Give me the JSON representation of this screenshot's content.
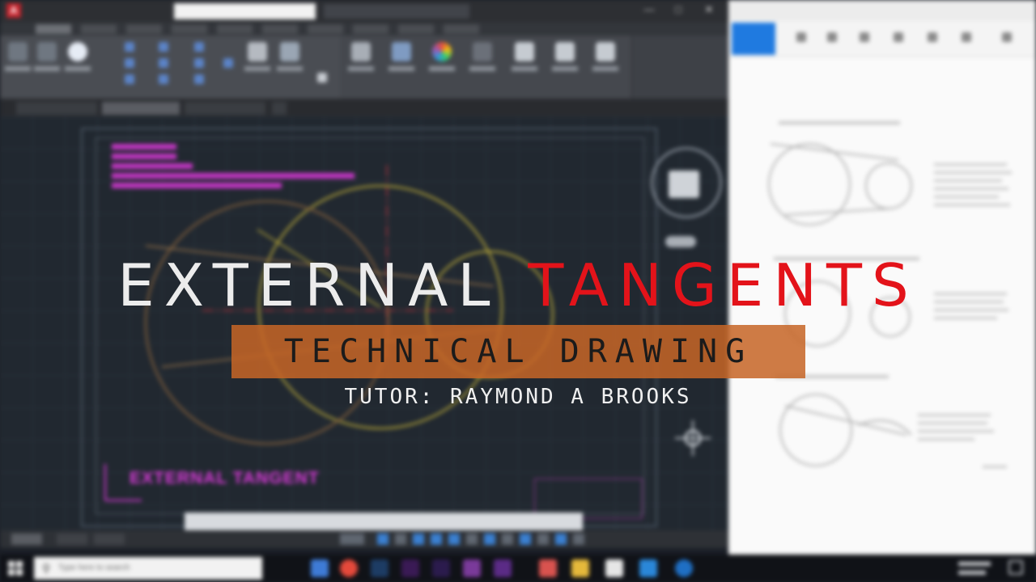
{
  "overlay": {
    "headline_word1": "EXTERNAL",
    "headline_word2": "TANGENTS",
    "subtitle": "TECHNICAL DRAWING",
    "tutor": "TUTOR: RAYMOND A BROOKS",
    "colors": {
      "headline_white": "#ececec",
      "headline_red": "#e3131a",
      "subtitle_band": "#c66527",
      "subtitle_text": "#1b1b1b"
    }
  },
  "autocad": {
    "drawing_label": "EXTERNAL TANGENT",
    "colors": {
      "annotation_magenta": "#d93ad9",
      "circle_yellow": "#c9b63a",
      "circle_brown": "#7a5a3a",
      "center_line_red": "#c8232c",
      "model_space": "#212830"
    }
  },
  "taskbar": {
    "search_placeholder": "Type here to search",
    "apps": [
      "file-explorer-icon",
      "chrome-icon",
      "photoshop-icon",
      "premiere-icon",
      "after-effects-icon",
      "onenote-icon",
      "autocad-icon",
      "folder-icon",
      "notepad-icon",
      "store-icon",
      "outlook-icon"
    ]
  }
}
